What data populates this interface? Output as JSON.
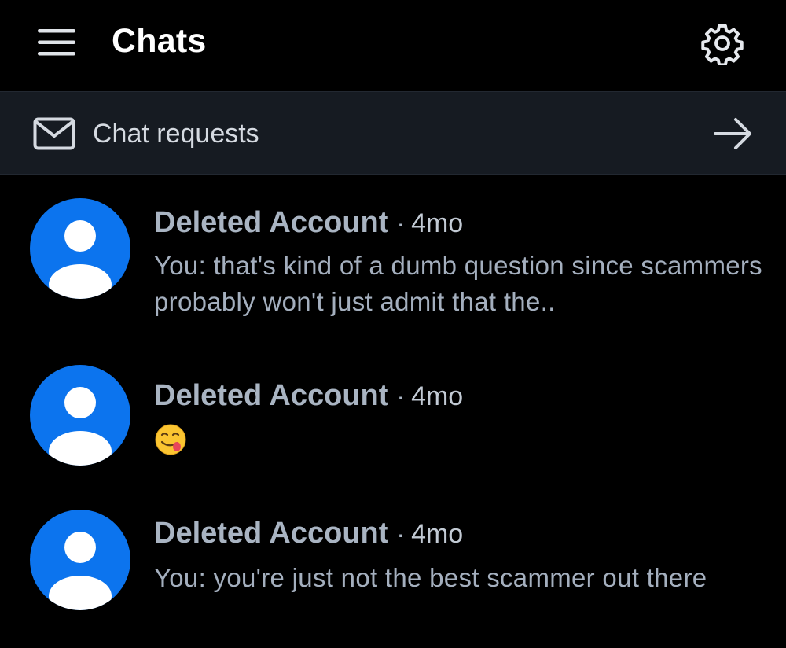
{
  "header": {
    "title": "Chats",
    "menu_icon": "hamburger-menu-icon",
    "settings_icon": "gear-icon"
  },
  "requests": {
    "label": "Chat requests",
    "icon": "mail-icon",
    "arrow_icon": "arrow-right-icon"
  },
  "chats": [
    {
      "name": "Deleted Account",
      "separator": "·",
      "time": "4mo",
      "preview": "You: that's kind of a dumb question since scammers probably won't just admit that the.."
    },
    {
      "name": "Deleted Account",
      "separator": "·",
      "time": "4mo",
      "preview_emoji": "face-savoring-food-emoji"
    },
    {
      "name": "Deleted Account",
      "separator": "·",
      "time": "4mo",
      "preview": "You: you're just not the best scammer out there"
    }
  ],
  "colors": {
    "background": "#000000",
    "requests_bar": "#161b22",
    "avatar": "#0c74ee",
    "name_text": "#a9b4c2",
    "preview_text": "#a4afbe"
  }
}
